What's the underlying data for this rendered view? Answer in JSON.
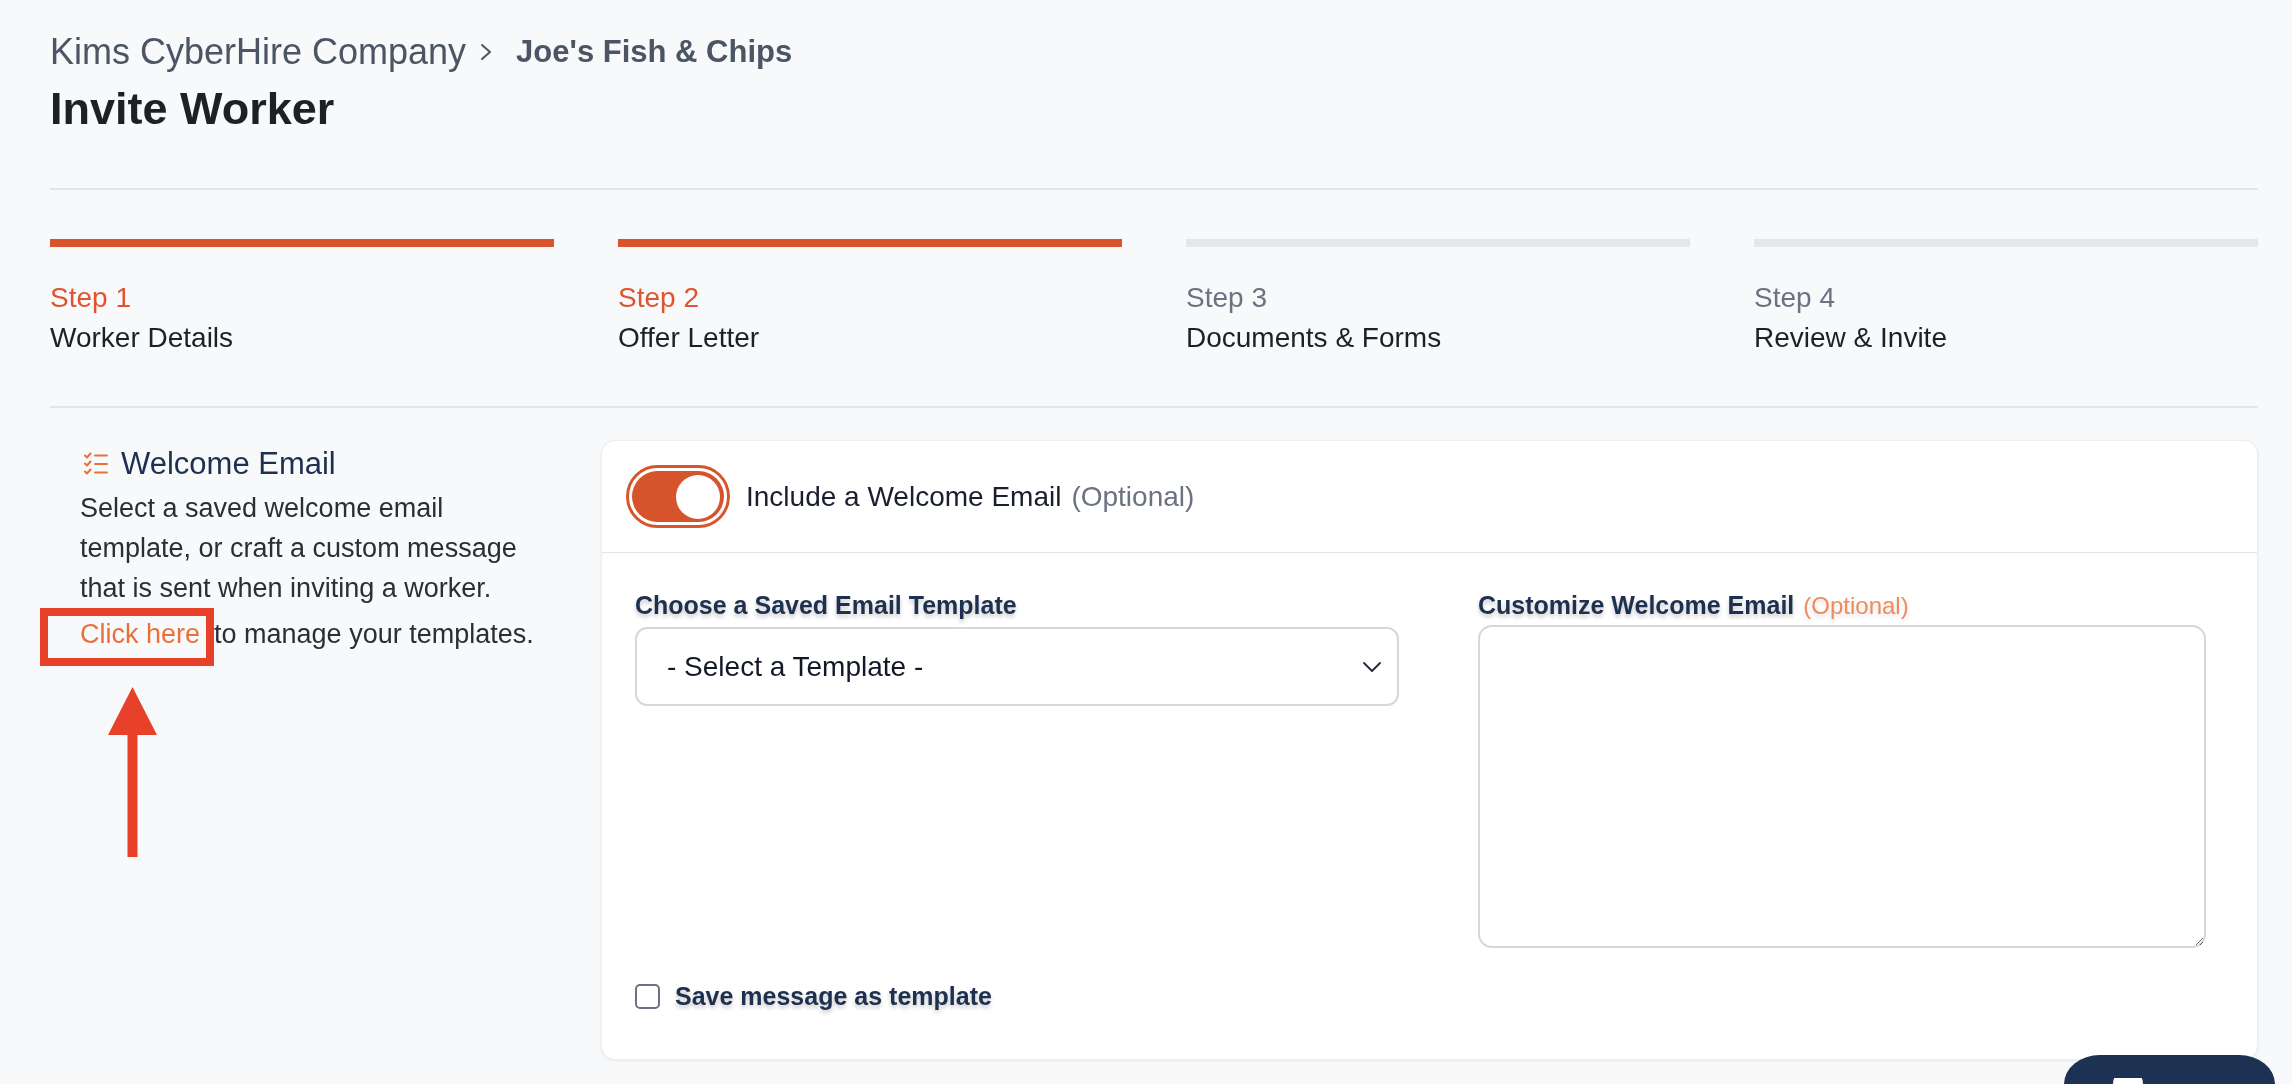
{
  "breadcrumb": [
    {
      "label": "Kims CyberHire Company",
      "current": false
    },
    {
      "label": "Joe's Fish & Chips",
      "current": true
    }
  ],
  "page_title": "Invite Worker",
  "steps": [
    {
      "label": "Step 1",
      "title": "Worker Details",
      "reached": true
    },
    {
      "label": "Step 2",
      "title": "Offer Letter",
      "reached": true
    },
    {
      "label": "Step 3",
      "title": "Documents & Forms",
      "reached": false
    },
    {
      "label": "Step 4",
      "title": "Review & Invite",
      "reached": false
    }
  ],
  "section": {
    "title": "Welcome Email",
    "text": "Select a saved welcome email template, or craft a custom message that is sent when inviting a worker.",
    "link": "Click here",
    "link_tail": "to manage your templates."
  },
  "card": {
    "toggle": {
      "label": "Include a Welcome Email",
      "hint": "(Optional)",
      "on": true
    },
    "template_field": {
      "label": "Choose a Saved Email Template",
      "value": "- Select a Template -"
    },
    "message_field": {
      "label": "Customize Welcome Email",
      "hint": "(Optional)"
    },
    "save_checkbox": {
      "label": "Save message as template",
      "checked": false
    }
  }
}
